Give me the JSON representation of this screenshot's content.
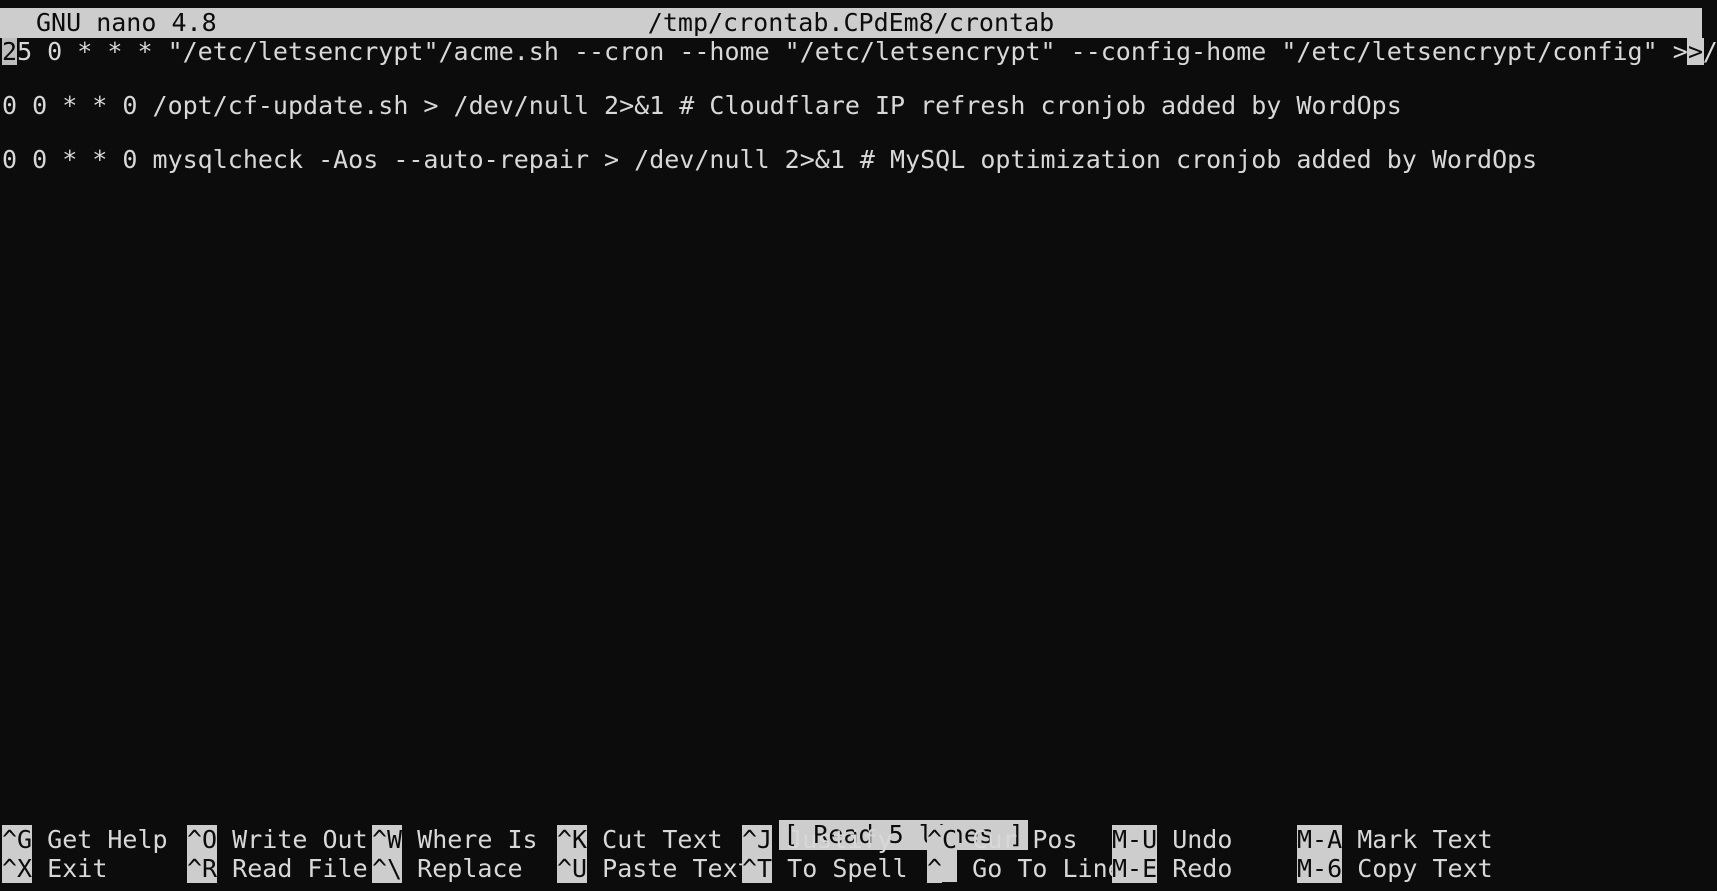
{
  "app": {
    "name": "GNU nano",
    "version_line": "GNU nano 4.8",
    "filename": "/tmp/crontab.CPdEm8/crontab"
  },
  "editor": {
    "cursor": {
      "row": 1,
      "col": 1,
      "char": "2"
    },
    "continuation_marker": ">",
    "lines": [
      {
        "n": 1,
        "text": "25 0 * * * \"/etc/letsencrypt\"/acme.sh --cron --home \"/etc/letsencrypt\" --config-home \"/etc/letsencrypt/config\" > /dev/n",
        "truncated": true,
        "cursor_at": 0
      },
      {
        "n": 2,
        "text": "",
        "truncated": false
      },
      {
        "n": 3,
        "text": "0 0 * * 0 /opt/cf-update.sh > /dev/null 2>&1 # Cloudflare IP refresh cronjob added by WordOps",
        "truncated": false
      },
      {
        "n": 4,
        "text": "",
        "truncated": false
      },
      {
        "n": 5,
        "text": "0 0 * * 0 mysqlcheck -Aos --auto-repair > /dev/null 2>&1 # MySQL optimization cronjob added by WordOps",
        "truncated": false
      }
    ]
  },
  "status": {
    "message": "[ Read 5 lines ]"
  },
  "shortcuts": [
    [
      {
        "key": "^G",
        "label": " Get Help"
      },
      {
        "key": "^X",
        "label": " Exit"
      }
    ],
    [
      {
        "key": "^O",
        "label": " Write Out"
      },
      {
        "key": "^R",
        "label": " Read File"
      }
    ],
    [
      {
        "key": "^W",
        "label": " Where Is"
      },
      {
        "key": "^\\",
        "label": " Replace"
      }
    ],
    [
      {
        "key": "^K",
        "label": " Cut Text"
      },
      {
        "key": "^U",
        "label": " Paste Text"
      }
    ],
    [
      {
        "key": "^J",
        "label": " Justify"
      },
      {
        "key": "^T",
        "label": " To Spell"
      }
    ],
    [
      {
        "key": "^C",
        "label": " Cur Pos"
      },
      {
        "key": "^_",
        "label": " Go To Line"
      }
    ],
    [
      {
        "key": "M-U",
        "label": " Undo"
      },
      {
        "key": "M-E",
        "label": " Redo"
      }
    ],
    [
      {
        "key": "M-A",
        "label": " Mark Text"
      },
      {
        "key": "M-6",
        "label": " Copy Text"
      }
    ]
  ],
  "colors": {
    "background": "#0c0c0c",
    "foreground": "#d8d8d8",
    "reverse_background": "#cdcdcd",
    "reverse_foreground": "#0c0c0c",
    "cursor_background": "#bdbdbd"
  }
}
